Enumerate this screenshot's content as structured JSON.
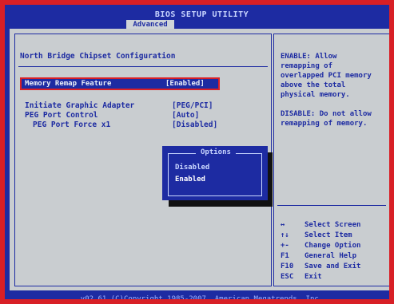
{
  "header": {
    "title": "BIOS SETUP UTILITY",
    "active_tab": "Advanced"
  },
  "main": {
    "section_title": "North Bridge Chipset Configuration",
    "rows": [
      {
        "label": "Memory Remap Feature",
        "value": "[Enabled]"
      },
      {
        "label": "Initiate Graphic Adapter",
        "value": "[PEG/PCI]"
      },
      {
        "label": "PEG Port Control",
        "value": "[Auto]"
      },
      {
        "label": "PEG Port Force x1",
        "value": "[Disabled]"
      }
    ]
  },
  "popup": {
    "title": "Options",
    "options": [
      "Disabled",
      "Enabled"
    ],
    "selected": "Enabled"
  },
  "help": {
    "text": "ENABLE: Allow\nremapping of\noverlapped PCI memory\nabove the total\nphysical memory.\n\nDISABLE: Do not allow\nremapping of memory.",
    "keys": [
      {
        "key": "↔",
        "desc": "Select Screen"
      },
      {
        "key": "↑↓",
        "desc": "Select Item"
      },
      {
        "key": "+-",
        "desc": "Change Option"
      },
      {
        "key": "F1",
        "desc": "General Help"
      },
      {
        "key": "F10",
        "desc": "Save and Exit"
      },
      {
        "key": "ESC",
        "desc": "Exit"
      }
    ]
  },
  "footer": {
    "copyright": "v02.61 (C)Copyright 1985-2007, American Megatrends, Inc."
  },
  "colors": {
    "frame": "#d81f26",
    "bios_blue": "#1d2ba2",
    "bios_gray": "#c9cdd0"
  }
}
